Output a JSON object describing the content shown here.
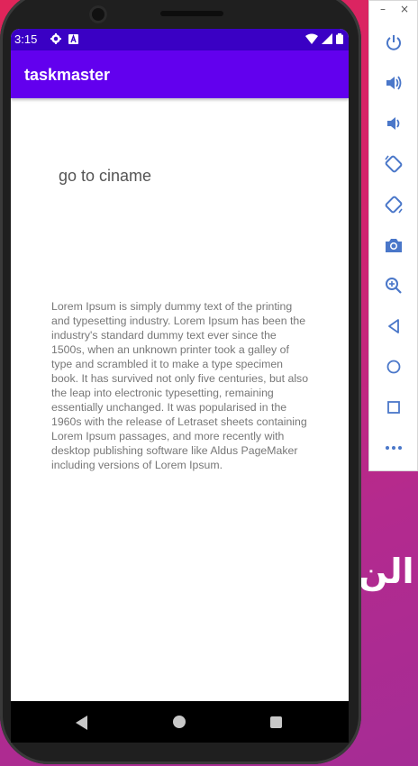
{
  "status_bar": {
    "time": "3:15"
  },
  "app_bar": {
    "title": "taskmaster"
  },
  "main": {
    "link_text": "go to ciname",
    "paragraph": "Lorem Ipsum is simply dummy text of the printing and typesetting industry. Lorem Ipsum has been the industry's standard dummy text ever since the 1500s, when an unknown printer took a galley of type and scrambled it to make a type specimen book. It has survived not only five centuries, but also the leap into electronic typesetting, remaining essentially unchanged. It was popularised in the 1960s with the release of Letraset sheets containing Lorem Ipsum passages, and more recently with desktop publishing software like Aldus PageMaker including versions of Lorem Ipsum."
  },
  "emulator_toolbar": {
    "window_controls": [
      "–",
      "×"
    ],
    "buttons": [
      "power-icon",
      "volume-up-icon",
      "volume-down-icon",
      "rotate-left-icon",
      "rotate-right-icon",
      "camera-icon",
      "zoom-icon",
      "back-icon",
      "home-icon",
      "overview-icon",
      "more-icon"
    ]
  },
  "background": {
    "glyph": "الن"
  },
  "colors": {
    "status_bar": "#3a00c4",
    "app_bar": "#6200ee",
    "emulator_icon": "#4a77c9"
  }
}
